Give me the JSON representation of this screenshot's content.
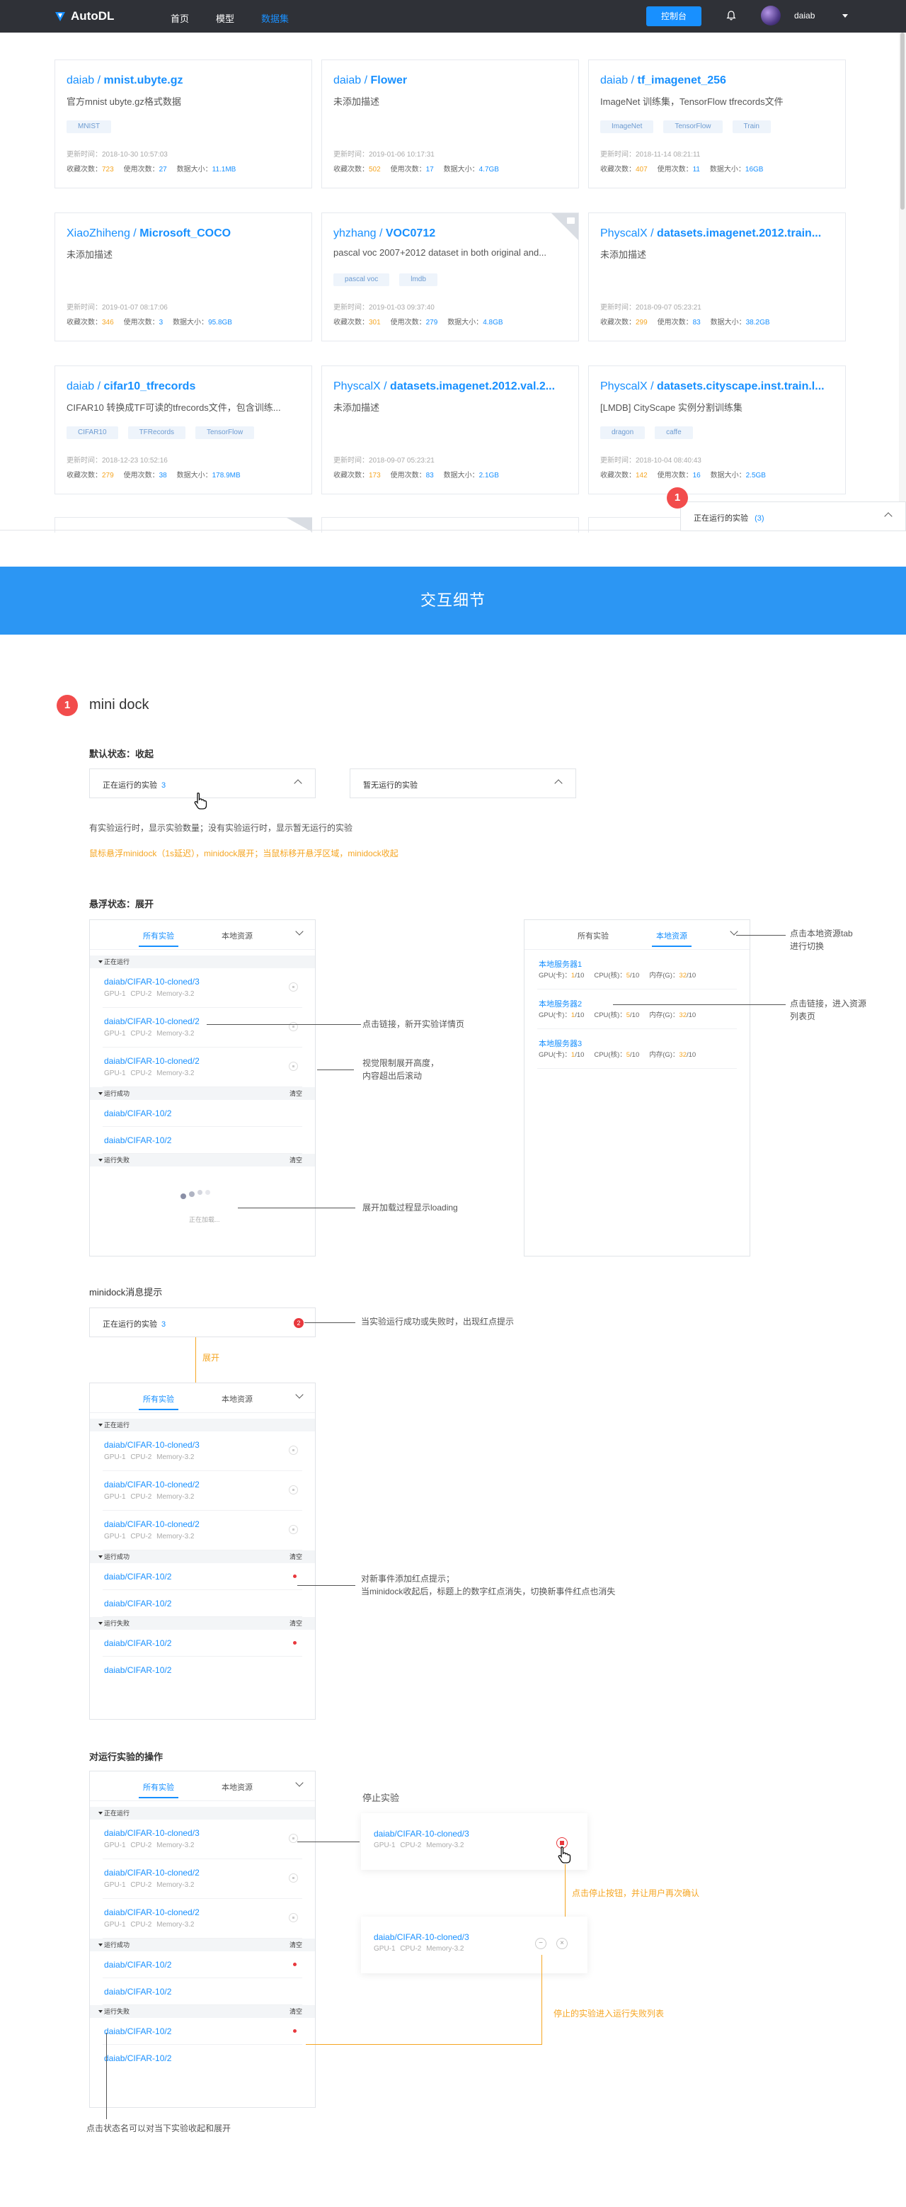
{
  "nav": {
    "logo": "AutoDL",
    "menu": [
      "首页",
      "模型",
      "数据集"
    ],
    "active_index": 2,
    "console_button": "控制台",
    "username": "daiab"
  },
  "datasets": [
    {
      "owner": "daiab",
      "name": "mnist.ubyte.gz",
      "desc": "官方mnist ubyte.gz格式数据",
      "tags": [
        "MNIST"
      ],
      "updated": "更新时间：2018-10-30 10:57:03",
      "fav": "723",
      "use": "27",
      "size": "11.1MB",
      "corner": false
    },
    {
      "owner": "daiab",
      "name": "Flower",
      "desc": "未添加描述",
      "tags": [],
      "updated": "更新时间：2019-01-06 10:17:31",
      "fav": "502",
      "use": "17",
      "size": "4.7GB",
      "corner": false
    },
    {
      "owner": "daiab",
      "name": "tf_imagenet_256",
      "desc": "ImageNet 训练集，TensorFlow tfrecords文件",
      "tags": [
        "ImageNet",
        "TensorFlow",
        "Train"
      ],
      "updated": "更新时间：2018-11-14 08:21:11",
      "fav": "407",
      "use": "11",
      "size": "16GB",
      "corner": false
    },
    {
      "owner": "XiaoZhiheng",
      "name": "Microsoft_COCO",
      "desc": "未添加描述",
      "tags": [],
      "updated": "更新时间：2019-01-07 08:17:06",
      "fav": "346",
      "use": "3",
      "size": "95.8GB",
      "corner": false
    },
    {
      "owner": "yhzhang",
      "name": "VOC0712",
      "desc": "pascal voc 2007+2012 dataset in both original and...",
      "tags": [
        "pascal voc",
        "lmdb"
      ],
      "updated": "更新时间：2019-01-03 09:37:40",
      "fav": "301",
      "use": "279",
      "size": "4.8GB",
      "corner": true
    },
    {
      "owner": "PhyscalX",
      "name": "datasets.imagenet.2012.train...",
      "desc": "未添加描述",
      "tags": [],
      "updated": "更新时间：2018-09-07 05:23:21",
      "fav": "299",
      "use": "83",
      "size": "38.2GB",
      "corner": false
    },
    {
      "owner": "daiab",
      "name": "cifar10_tfrecords",
      "desc": "CIFAR10 转换成TF可读的tfrecords文件，包含训练...",
      "tags": [
        "CIFAR10",
        "TFRecords",
        "TensorFlow"
      ],
      "updated": "更新时间：2018-12-23 10:52:16",
      "fav": "279",
      "use": "38",
      "size": "178.9MB",
      "corner": false
    },
    {
      "owner": "PhyscalX",
      "name": "datasets.imagenet.2012.val.2...",
      "desc": "未添加描述",
      "tags": [],
      "updated": "更新时间：2018-09-07 05:23:21",
      "fav": "173",
      "use": "83",
      "size": "2.1GB",
      "corner": false
    },
    {
      "owner": "PhyscalX",
      "name": "datasets.cityscape.inst.train.l...",
      "desc": "[LMDB] CityScape 实例分割训练集",
      "tags": [
        "dragon",
        "caffe"
      ],
      "updated": "更新时间：2018-10-04 08:40:43",
      "fav": "142",
      "use": "16",
      "size": "2.5GB",
      "corner": false
    }
  ],
  "stat_labels": {
    "fav": "收藏次数：",
    "use": "使用次数：",
    "size": "数据大小："
  },
  "mini_dock_top": {
    "label": "正在运行的实验",
    "count": "(3)",
    "badge": "1"
  },
  "band_title": "交互细节",
  "section1": {
    "num": "1",
    "title": "mini dock"
  },
  "default_state": {
    "heading": "默认状态：收起",
    "dock_running": "正在运行的实验",
    "dock_running_count": "3",
    "dock_none": "暂无运行的实验",
    "note1": "有实验运行时，显示实验数量；没有实验运行时，显示暂无运行的实验",
    "note2": "鼠标悬浮minidock（1s延迟），minidock展开；当鼠标移开悬浮区域，minidock收起"
  },
  "hover_state": {
    "heading": "悬浮状态：展开",
    "tab_all": "所有实验",
    "tab_local": "本地资源",
    "sec_running": "正在运行",
    "sec_success": "运行成功",
    "sec_failed": "运行失败",
    "clear": "清空",
    "running": [
      {
        "name": "daiab/CIFAR-10-cloned/3",
        "sub": "GPU-1 CPU-2 Memory-3.2"
      },
      {
        "name": "daiab/CIFAR-10-cloned/2",
        "sub": "GPU-1 CPU-2 Memory-3.2"
      },
      {
        "name": "daiab/CIFAR-10-cloned/2",
        "sub": "GPU-1 CPU-2 Memory-3.2"
      }
    ],
    "success": [
      "daiab/CIFAR-10/2",
      "daiab/CIFAR-10/2"
    ],
    "failed": [
      "daiab/CIFAR-10/2",
      "daiab/CIFAR-10/2"
    ],
    "loading": "正在加载...",
    "ann_link": "点击链接，新开实验详情页",
    "ann_scroll_1": "视觉限制展开高度，",
    "ann_scroll_2": "内容超出后滚动",
    "ann_loading": "展开加载过程显示loading",
    "servers": [
      {
        "name": "本地服务器1",
        "gpu": "GPU(卡)：",
        "gpu_v": "1",
        "gpu_t": "/10",
        "cpu": "CPU(核)：",
        "cpu_v": "5",
        "cpu_t": "/10",
        "mem": "内存(G)：",
        "mem_v": "32",
        "mem_t": "/10"
      },
      {
        "name": "本地服务器2",
        "gpu": "GPU(卡)：",
        "gpu_v": "1",
        "gpu_t": "/10",
        "cpu": "CPU(核)：",
        "cpu_v": "5",
        "cpu_t": "/10",
        "mem": "内存(G)：",
        "mem_v": "32",
        "mem_t": "/10"
      },
      {
        "name": "本地服务器3",
        "gpu": "GPU(卡)：",
        "gpu_v": "1",
        "gpu_t": "/10",
        "cpu": "CPU(核)：",
        "cpu_v": "5",
        "cpu_t": "/10",
        "mem": "内存(G)：",
        "mem_v": "32",
        "mem_t": "/10"
      }
    ],
    "ann_tab_1": "点击本地资源tab",
    "ann_tab_2": "进行切换",
    "ann_res_1": "点击链接，进入资源",
    "ann_res_2": "列表页"
  },
  "message_state": {
    "heading": "minidock消息提示",
    "badge": "2",
    "ann_badge": "当实验运行成功或失败时，出现红点提示",
    "expand": "展开",
    "ann_dot_1": "对新事件添加红点提示；",
    "ann_dot_2": "当minidock收起后，标题上的数字红点消失，切换新事件红点也消失"
  },
  "ops_state": {
    "heading": "对运行实验的操作",
    "stop_title": "停止实验",
    "stop_item": {
      "name": "daiab/CIFAR-10-cloned/3",
      "sub": "GPU-1 CPU-2 Memory-3.2"
    },
    "ann_stop": "点击停止按钮，并让用户再次确认",
    "ann_failed": "停止的实验进入运行失败列表",
    "ann_collapse": "点击状态名可以对当下实验收起和展开"
  }
}
